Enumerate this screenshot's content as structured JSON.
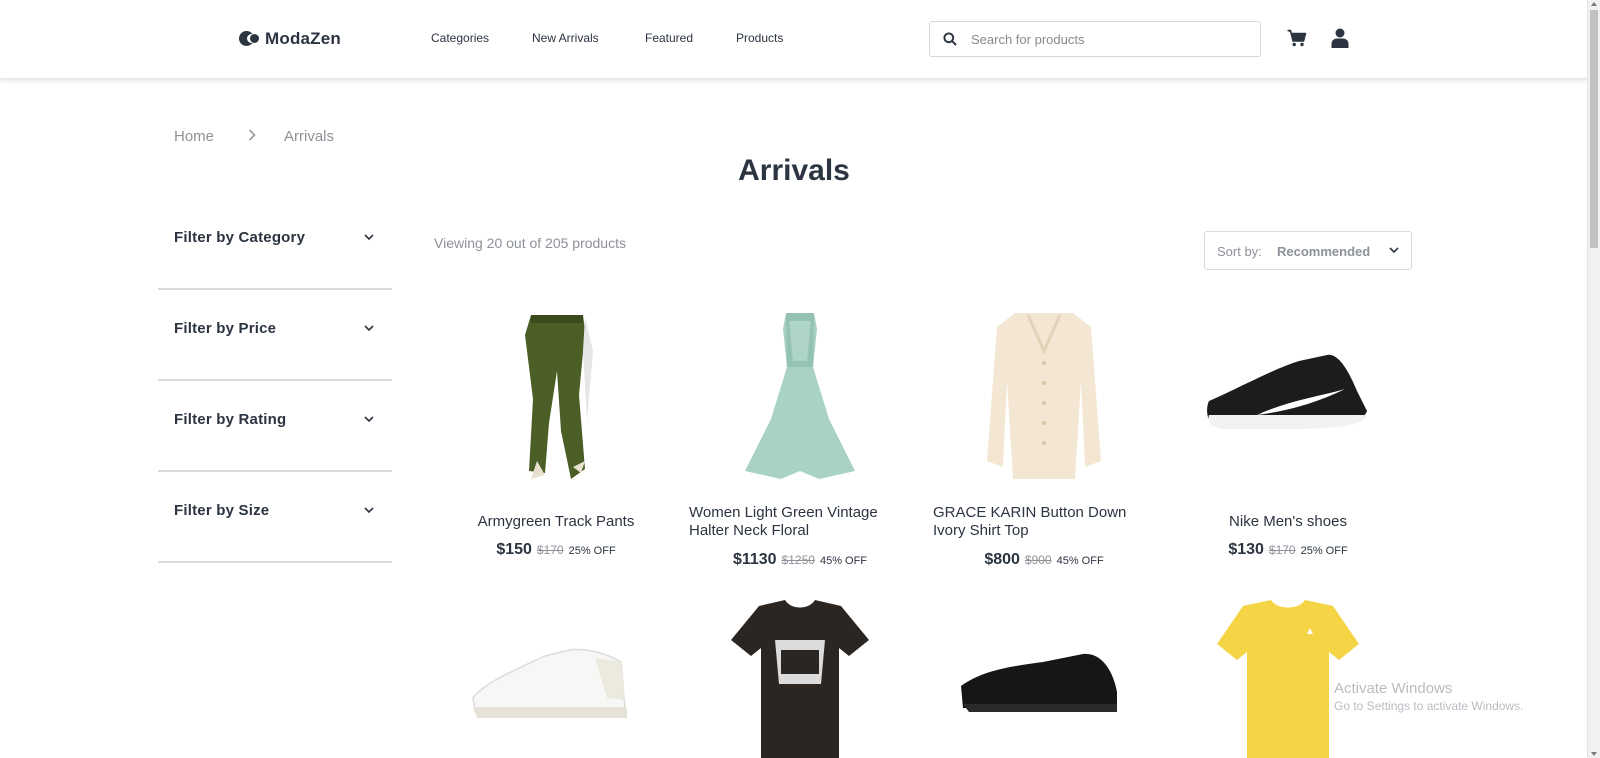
{
  "brand": {
    "name": "ModaZen"
  },
  "nav": [
    {
      "label": "Categories"
    },
    {
      "label": "New Arrivals"
    },
    {
      "label": "Featured"
    },
    {
      "label": "Products"
    }
  ],
  "search": {
    "placeholder": "Search for products",
    "value": ""
  },
  "header_icons": [
    "cart-icon",
    "user-icon"
  ],
  "breadcrumb": {
    "home": "Home",
    "separator": ">",
    "current": "Arrivals"
  },
  "page": {
    "title": "Arrivals",
    "viewing": "Viewing 20 out of 205 products"
  },
  "sort": {
    "label": "Sort by:",
    "value": "Recommended"
  },
  "filters": [
    {
      "label": "Filter by Category"
    },
    {
      "label": "Filter by Price"
    },
    {
      "label": "Filter by Rating"
    },
    {
      "label": "Filter by Size"
    }
  ],
  "products": [
    {
      "name": "Armygreen Track Pants",
      "price": "$150",
      "old_price": "$170",
      "discount": "25% OFF"
    },
    {
      "name": "Women Light Green Vintage Halter Neck Floral",
      "price": "$1130",
      "old_price": "$1250",
      "discount": "45% OFF"
    },
    {
      "name": "GRACE KARIN Button Down Ivory Shirt Top",
      "price": "$800",
      "old_price": "$900",
      "discount": "45% OFF"
    },
    {
      "name": "Nike Men's shoes",
      "price": "$130",
      "old_price": "$170",
      "discount": "25% OFF"
    }
  ],
  "watermark": {
    "title": "Activate Windows",
    "subtitle": "Go to Settings to activate Windows."
  },
  "colors": {
    "text": "#2b3440",
    "muted": "#8d9198",
    "border": "#d9dbde"
  }
}
